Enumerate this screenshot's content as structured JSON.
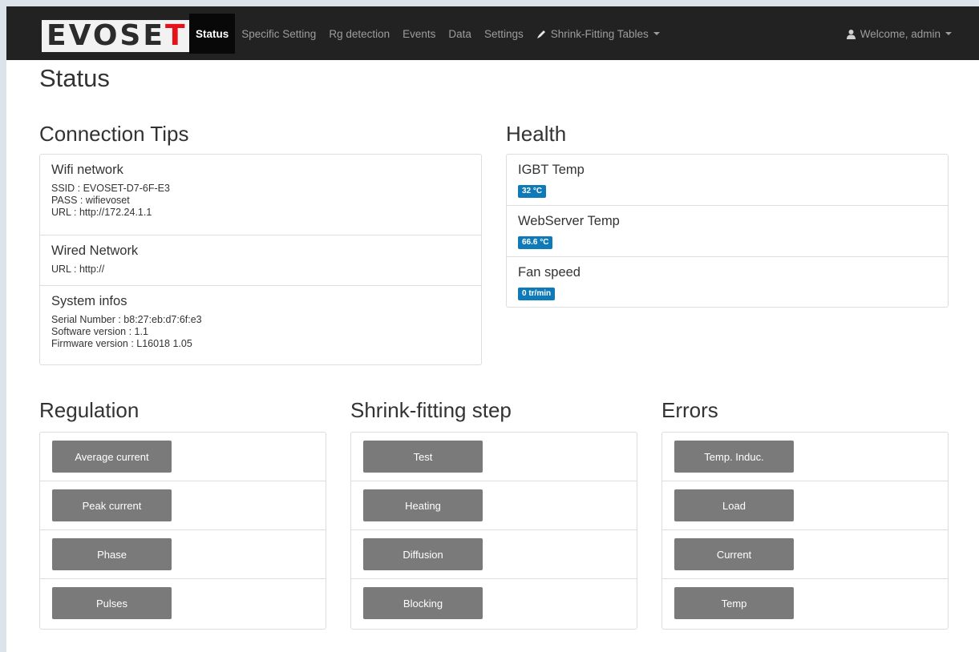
{
  "brand": {
    "logo_text_plain": "EVOSE",
    "logo_text_accent": "T"
  },
  "nav": {
    "items": [
      {
        "label": "Status"
      },
      {
        "label": "Specific Setting"
      },
      {
        "label": "Rg detection"
      },
      {
        "label": "Events"
      },
      {
        "label": "Data"
      },
      {
        "label": "Settings"
      },
      {
        "label": "Shrink-Fitting Tables",
        "icon": "pencil-icon"
      }
    ],
    "user_label": "Welcome, admin",
    "user_icon": "user-icon"
  },
  "page": {
    "title": "Status"
  },
  "connection": {
    "title": "Connection Tips",
    "wifi": {
      "heading": "Wifi network",
      "ssid": "SSID : EVOSET-D7-6F-E3",
      "pass": "PASS : wifievoset",
      "url": "URL : http://172.24.1.1"
    },
    "wired": {
      "heading": "Wired Network",
      "url": "URL : http://"
    },
    "system": {
      "heading": "System infos",
      "serial": "Serial Number : b8:27:eb:d7:6f:e3",
      "software": "Software version : 1.1",
      "firmware": "Firmware version : L16018 1.05"
    }
  },
  "health": {
    "title": "Health",
    "items": [
      {
        "label": "IGBT Temp",
        "value": "32 °C"
      },
      {
        "label": "WebServer Temp",
        "value": "66.6 °C"
      },
      {
        "label": "Fan speed",
        "value": "0 tr/min"
      }
    ]
  },
  "regulation": {
    "title": "Regulation",
    "buttons": [
      "Average current",
      "Peak current",
      "Phase",
      "Pulses"
    ]
  },
  "shrink": {
    "title": "Shrink-fitting step",
    "buttons": [
      "Test",
      "Heating",
      "Diffusion",
      "Blocking"
    ]
  },
  "errors": {
    "title": "Errors",
    "buttons": [
      "Temp. Induc.",
      "Load",
      "Current",
      "Temp"
    ]
  },
  "colors": {
    "navbar": "#222222",
    "badge": "#0f7ab8",
    "button": "#7a7a7a",
    "logo_accent": "#e3121b"
  }
}
